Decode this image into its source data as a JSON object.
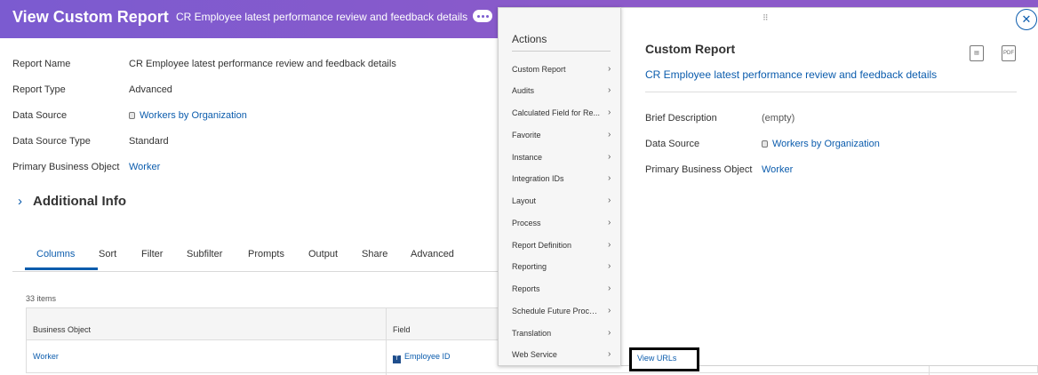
{
  "header": {
    "title": "View Custom Report",
    "subtitle": "CR Employee latest performance review and feedback details"
  },
  "details": [
    {
      "label": "Report Name",
      "value": "CR Employee latest performance review and feedback details",
      "link": false
    },
    {
      "label": "Report Type",
      "value": "Advanced",
      "link": false
    },
    {
      "label": "Data Source",
      "value": "Workers by Organization",
      "link": true
    },
    {
      "label": "Data Source Type",
      "value": "Standard",
      "link": false
    },
    {
      "label": "Primary Business Object",
      "value": "Worker",
      "link": true
    }
  ],
  "additional_info": "Additional Info",
  "tabs": [
    "Columns",
    "Sort",
    "Filter",
    "Subfilter",
    "Prompts",
    "Output",
    "Share",
    "Advanced"
  ],
  "active_tab": "Columns",
  "items_count": "33 items",
  "table": {
    "headers": [
      "Business Object",
      "Field"
    ],
    "rows": [
      {
        "business_object": "Worker",
        "field": "Employee ID",
        "field_icon": "T"
      }
    ]
  },
  "menu": {
    "header": "Actions",
    "items": [
      "Custom Report",
      "Audits",
      "Calculated Field for Re...",
      "Favorite",
      "Instance",
      "Integration IDs",
      "Layout",
      "Process",
      "Report Definition",
      "Reporting",
      "Reports",
      "Schedule Future Process",
      "Translation",
      "Web Service"
    ]
  },
  "related": {
    "title": "Custom Report",
    "report_link": "CR Employee latest performance review and feedback details",
    "brief_description_label": "Brief Description",
    "brief_description_value": "(empty)",
    "data_source_label": "Data Source",
    "data_source_value": "Workers by Organization",
    "pbo_label": "Primary Business Object",
    "pbo_value": "Worker",
    "pdf_label": "PDF",
    "view_urls": "View URLs"
  },
  "colors": {
    "header_bg": "#7b5bd0",
    "link": "#0b5cad"
  }
}
